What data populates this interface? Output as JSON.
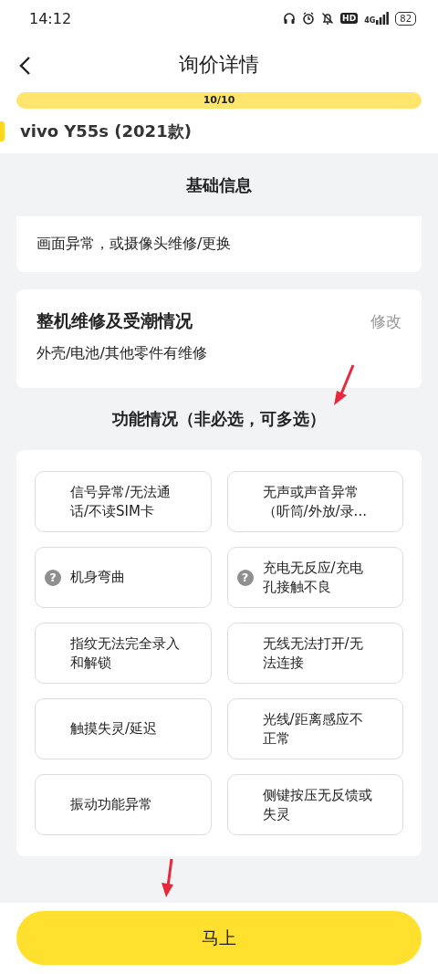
{
  "status_bar": {
    "time": "14:12",
    "hd": "HD",
    "network": "4G",
    "battery": "82"
  },
  "header": {
    "title": "询价详情"
  },
  "progress": {
    "label": "10/10",
    "level": 1
  },
  "model": {
    "name": "vivo Y55s (2021款)"
  },
  "basic_info": {
    "heading": "基础信息",
    "cards": [
      {
        "kind": "plain",
        "value": "画面异常，或摄像头维修/更换"
      },
      {
        "kind": "titled",
        "title": "整机维修及受潮情况",
        "action": "修改",
        "value": "外壳/电池/其他零件有维修"
      }
    ]
  },
  "functions": {
    "heading": "功能情况（非必选，可多选）",
    "options": [
      {
        "label": "信号异常/无法通话/不读SIM卡",
        "selected": false
      },
      {
        "label": "无声或声音异常（听筒/外放/录...",
        "selected": false
      },
      {
        "label": "机身弯曲",
        "selected": false,
        "help": "?"
      },
      {
        "label": "充电无反应/充电孔接触不良",
        "selected": false,
        "help": "?"
      },
      {
        "label": "指纹无法完全录入和解锁",
        "selected": false
      },
      {
        "label": "无线无法打开/无法连接",
        "selected": false
      },
      {
        "label": "触摸失灵/延迟",
        "selected": false
      },
      {
        "label": "光线/距离感应不正常",
        "selected": false
      },
      {
        "label": "振动功能异常",
        "selected": false
      },
      {
        "label": "侧键按压无反馈或失灵",
        "selected": false
      }
    ]
  },
  "submit": {
    "label": "马上"
  },
  "annotations": {
    "heading_arrow": true,
    "submit_arrow": true
  }
}
